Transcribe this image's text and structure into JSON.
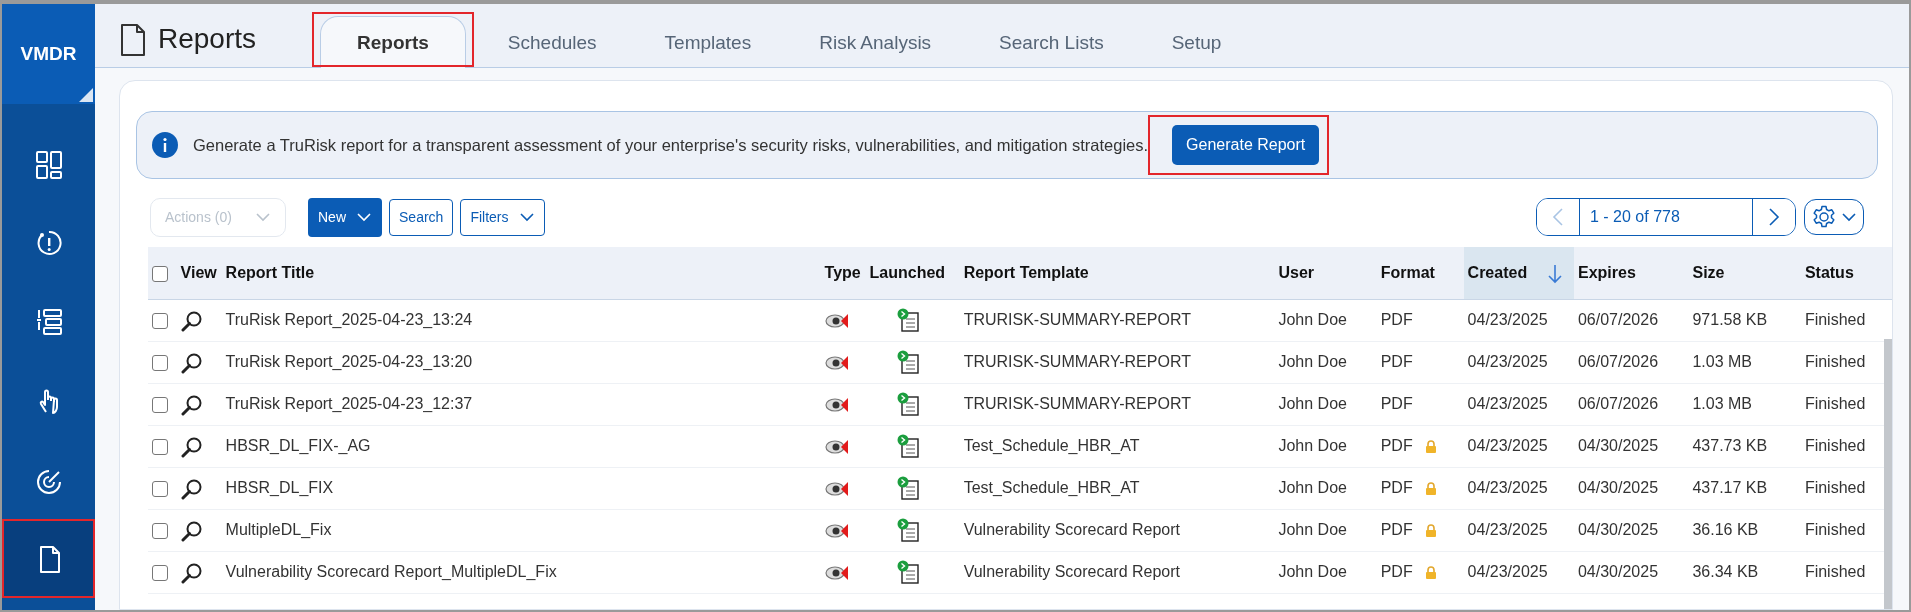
{
  "sidebar": {
    "brand": "VMDR",
    "items": [
      {
        "kind": "dashboard",
        "selected": false,
        "highlighted": false
      },
      {
        "kind": "alert",
        "selected": false,
        "highlighted": false
      },
      {
        "kind": "list",
        "selected": false,
        "highlighted": false
      },
      {
        "kind": "touch",
        "selected": false,
        "highlighted": false
      },
      {
        "kind": "gauge",
        "selected": false,
        "highlighted": false
      },
      {
        "kind": "document",
        "selected": true,
        "highlighted": true
      }
    ]
  },
  "header": {
    "title": "Reports"
  },
  "tabs": [
    {
      "label": "Reports",
      "selected": true,
      "highlighted": true
    },
    {
      "label": "Schedules",
      "selected": false,
      "highlighted": false
    },
    {
      "label": "Templates",
      "selected": false,
      "highlighted": false
    },
    {
      "label": "Risk Analysis",
      "selected": false,
      "highlighted": false
    },
    {
      "label": "Search Lists",
      "selected": false,
      "highlighted": false
    },
    {
      "label": "Setup",
      "selected": false,
      "highlighted": false
    }
  ],
  "banner": {
    "text": "Generate a TruRisk report for a transparent assessment of your enterprise's security risks, vulnerabilities, and mitigation strategies.",
    "button": {
      "label": "Generate Report",
      "highlighted": true
    }
  },
  "toolbar": {
    "actions": {
      "label": "Actions (0)",
      "disabled": true
    },
    "new": "New",
    "search": "Search",
    "filters": "Filters"
  },
  "pager": {
    "range": "1 - 20 of 778",
    "prev_disabled": true
  },
  "table": {
    "select_all": false,
    "columns": [
      {
        "label": "View",
        "sorted": false
      },
      {
        "label": "Report Title",
        "sorted": false
      },
      {
        "label": "Type",
        "sorted": false
      },
      {
        "label": "Launched",
        "sorted": false
      },
      {
        "label": "Report Template",
        "sorted": false
      },
      {
        "label": "User",
        "sorted": false
      },
      {
        "label": "Format",
        "sorted": false
      },
      {
        "label": "Created",
        "sorted": true
      },
      {
        "label": "Expires",
        "sorted": false
      },
      {
        "label": "Size",
        "sorted": false
      },
      {
        "label": "Status",
        "sorted": false
      }
    ],
    "rows": [
      {
        "checked": false,
        "title": "TruRisk Report_2025-04-23_13:24",
        "template": "TRURISK-SUMMARY-REPORT",
        "user": "John Doe",
        "format": "PDF",
        "locked": false,
        "created": "04/23/2025",
        "expires": "06/07/2026",
        "size": "971.58 KB",
        "status": "Finished"
      },
      {
        "checked": false,
        "title": "TruRisk Report_2025-04-23_13:20",
        "template": "TRURISK-SUMMARY-REPORT",
        "user": "John Doe",
        "format": "PDF",
        "locked": false,
        "created": "04/23/2025",
        "expires": "06/07/2026",
        "size": "1.03 MB",
        "status": "Finished"
      },
      {
        "checked": false,
        "title": "TruRisk Report_2025-04-23_12:37",
        "template": "TRURISK-SUMMARY-REPORT",
        "user": "John Doe",
        "format": "PDF",
        "locked": false,
        "created": "04/23/2025",
        "expires": "06/07/2026",
        "size": "1.03 MB",
        "status": "Finished"
      },
      {
        "checked": false,
        "title": "HBSR_DL_FIX-_AG",
        "template": "Test_Schedule_HBR_AT",
        "user": "John Doe",
        "format": "PDF",
        "locked": true,
        "created": "04/23/2025",
        "expires": "04/30/2025",
        "size": "437.73 KB",
        "status": "Finished"
      },
      {
        "checked": false,
        "title": "HBSR_DL_FIX",
        "template": "Test_Schedule_HBR_AT",
        "user": "John Doe",
        "format": "PDF",
        "locked": true,
        "created": "04/23/2025",
        "expires": "04/30/2025",
        "size": "437.17 KB",
        "status": "Finished"
      },
      {
        "checked": false,
        "title": "MultipleDL_Fix",
        "template": "Vulnerability Scorecard Report",
        "user": "John Doe",
        "format": "PDF",
        "locked": true,
        "created": "04/23/2025",
        "expires": "04/30/2025",
        "size": "36.16 KB",
        "status": "Finished"
      },
      {
        "checked": false,
        "title": "Vulnerability Scorecard Report_MultipleDL_Fix",
        "template": "Vulnerability Scorecard Report",
        "user": "John Doe",
        "format": "PDF",
        "locked": true,
        "created": "04/23/2025",
        "expires": "04/30/2025",
        "size": "36.34 KB",
        "status": "Finished"
      }
    ]
  }
}
